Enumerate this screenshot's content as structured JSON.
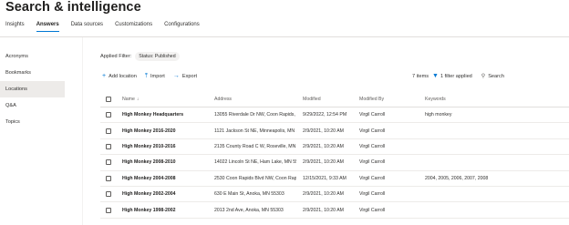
{
  "page": {
    "title": "Search & intelligence"
  },
  "tabs": [
    {
      "label": "Insights",
      "active": false
    },
    {
      "label": "Answers",
      "active": true
    },
    {
      "label": "Data sources",
      "active": false
    },
    {
      "label": "Customizations",
      "active": false
    },
    {
      "label": "Configurations",
      "active": false
    }
  ],
  "sidebar": {
    "items": [
      {
        "label": "Acronyms",
        "active": false
      },
      {
        "label": "Bookmarks",
        "active": false
      },
      {
        "label": "Locations",
        "active": true
      },
      {
        "label": "Q&A",
        "active": false
      },
      {
        "label": "Topics",
        "active": false
      }
    ]
  },
  "filter": {
    "label": "Applied Filter:",
    "chip": "Status: Published"
  },
  "toolbar": {
    "add_label": "Add location",
    "import_label": "Import",
    "export_label": "Export",
    "items_count": "7 items",
    "filter_applied": "1 filter applied",
    "search_label": "Search",
    "icons": {
      "add": "plus-icon",
      "import": "upload-icon",
      "export": "arrow-right-icon",
      "filter": "funnel-icon",
      "search": "search-icon"
    },
    "accent_color": "#0078d4"
  },
  "table": {
    "columns": {
      "name": "Name",
      "sort": "↓",
      "address": "Address",
      "modified": "Modified",
      "modified_by": "Modified By",
      "keywords": "Keywords"
    },
    "rows": [
      {
        "name": "High Monkey Headquarters",
        "address": "13055 Riverdale Dr NW, Coon Rapids, ...",
        "modified": "9/29/2022, 12:54 PM",
        "modified_by": "Virgil Carroll",
        "keywords": "high monkey"
      },
      {
        "name": "High Monkey 2016-2020",
        "address": "1121 Jackson St NE, Minneapolis, MN 5...",
        "modified": "2/9/2021, 10:20 AM",
        "modified_by": "Virgil Carroll",
        "keywords": ""
      },
      {
        "name": "High Monkey 2010-2016",
        "address": "2135 County Road C W, Roseville, MN 5...",
        "modified": "2/9/2021, 10:20 AM",
        "modified_by": "Virgil Carroll",
        "keywords": ""
      },
      {
        "name": "High Monkey 2008-2010",
        "address": "14022 Lincoln St NE, Ham Lake, MN 55...",
        "modified": "2/9/2021, 10:20 AM",
        "modified_by": "Virgil Carroll",
        "keywords": ""
      },
      {
        "name": "High Monkey 2004-2008",
        "address": "2530 Coon Rapids Blvd NW, Coon Rapi...",
        "modified": "12/15/2021, 9:33 AM",
        "modified_by": "Virgil Carroll",
        "keywords": "2004, 2005, 2006, 2007, 2008"
      },
      {
        "name": "High Monkey 2002-2004",
        "address": "630 E Main St, Anoka, MN 55303",
        "modified": "2/9/2021, 10:20 AM",
        "modified_by": "Virgil Carroll",
        "keywords": ""
      },
      {
        "name": "High Monkey 1998-2002",
        "address": "2013 2nd Ave, Anoka, MN 55303",
        "modified": "2/9/2021, 10:20 AM",
        "modified_by": "Virgil Carroll",
        "keywords": ""
      }
    ]
  }
}
